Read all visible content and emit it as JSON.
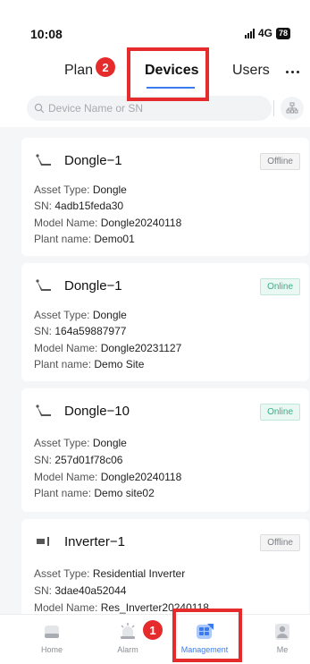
{
  "status_bar": {
    "time": "10:08",
    "network": "4G",
    "battery": "78"
  },
  "tabs": [
    {
      "label": "Plan"
    },
    {
      "label": "Devices",
      "active": true
    },
    {
      "label": "Users"
    }
  ],
  "search": {
    "placeholder": "Device Name or SN"
  },
  "labels": {
    "asset_type": "Asset Type:",
    "sn": "SN:",
    "model_name": "Model Name:",
    "plant_name": "Plant name:"
  },
  "devices": [
    {
      "name": "Dongle−1",
      "status": "Offline",
      "asset_type": "Dongle",
      "sn": "4adb15feda30",
      "model_name": "Dongle20240118",
      "plant_name": "Demo01",
      "icon": "dongle-icon"
    },
    {
      "name": "Dongle−1",
      "status": "Online",
      "asset_type": "Dongle",
      "sn": "164a59887977",
      "model_name": "Dongle20231127",
      "plant_name": "Demo Site",
      "icon": "dongle-icon"
    },
    {
      "name": "Dongle−10",
      "status": "Online",
      "asset_type": "Dongle",
      "sn": "257d01f78c06",
      "model_name": "Dongle20240118",
      "plant_name": "Demo site02",
      "icon": "dongle-icon"
    },
    {
      "name": "Inverter−1",
      "status": "Offline",
      "asset_type": "Residential Inverter",
      "sn": "3dae40a52044",
      "model_name": "Res_Inverter20240118",
      "icon": "inverter-icon"
    }
  ],
  "bottom_nav": [
    {
      "label": "Home",
      "icon": "home-icon"
    },
    {
      "label": "Alarm",
      "icon": "alarm-icon"
    },
    {
      "label": "Management",
      "icon": "management-icon",
      "active": true
    },
    {
      "label": "Me",
      "icon": "user-icon"
    }
  ],
  "annotations": {
    "step_1": "1",
    "step_2": "2",
    "highlight_color": "#e52b2b"
  },
  "colors": {
    "accent": "#3a7cf0",
    "online": "#33b08a",
    "offline": "#7a7d82"
  }
}
